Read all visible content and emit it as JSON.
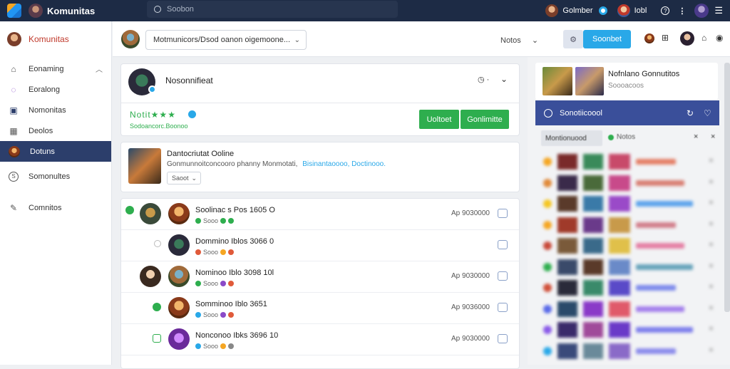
{
  "topbar": {
    "brand": "Komunitas",
    "search_placeholder": "Soobon",
    "user1": "Golmber",
    "user2": "Iobl"
  },
  "sidebar": {
    "header": "Komunitas",
    "items": [
      {
        "label": "Eonaming",
        "icon": "home-icon"
      },
      {
        "label": "Eoralong",
        "icon": "leaf-icon"
      },
      {
        "label": "Nomonitas",
        "icon": "store-icon"
      },
      {
        "label": "Deolos",
        "icon": "calendar-icon"
      },
      {
        "label": "Dotuns",
        "icon": "user-icon"
      },
      {
        "label": "Somonultes",
        "icon": "circle-s-icon"
      },
      {
        "label": "Comnitos",
        "icon": "pen-icon"
      }
    ]
  },
  "subbar": {
    "select_value": "Motmunicors/Dsod oanon oigemoone...",
    "notes": "Notos",
    "primary_button": "Soonbet"
  },
  "profile": {
    "name": "Nosonnifieat",
    "status": "Notit★★★",
    "sub": "Sodoancorc.Boonoo",
    "btn1": "Uoltoet",
    "btn2": "Gonlimitte",
    "colors": {
      "green": "#2eae4e",
      "blue": "#29a8e8"
    }
  },
  "post": {
    "title": "Dantocriutat Ooline",
    "text": "Gonmunnoitconcooro phanny Monmotati,",
    "link": "Bisinantaoooo, Doctinooo.",
    "button": "Saoot"
  },
  "members": [
    {
      "name": "Soolinac s Pos 1605 O",
      "time": "Ap 9030000",
      "meta": "Sooo"
    },
    {
      "name": "Dommino Iblos 3066 0",
      "time": "",
      "meta": "Sooo"
    },
    {
      "name": "Nominoo Iblo 3098 10l",
      "time": "Ap 9030000",
      "meta": "Sooo"
    },
    {
      "name": "Somminoo Iblo 3651",
      "time": "Ap 9036000",
      "meta": "Sooo"
    },
    {
      "name": "Nonconoo Ibks 3696 10",
      "time": "Ap 9030000",
      "meta": "Sooo"
    }
  ],
  "right_panel": {
    "title": "Nofnlano Gonnutitos",
    "sub": "Soooacoos",
    "bar": "Sonotiicoool",
    "filter": "Montionuood",
    "filter2": "Notos"
  }
}
